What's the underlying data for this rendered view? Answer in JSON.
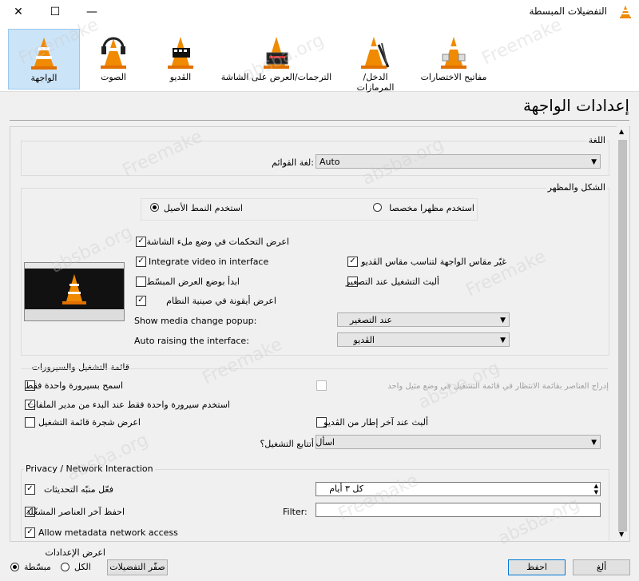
{
  "window": {
    "title": "التفضيلات المبسطة",
    "min": "—",
    "max": "☐",
    "close": "✕"
  },
  "categories": [
    {
      "label": "الواجهة",
      "icon": "interface-cone-icon"
    },
    {
      "label": "الصوت",
      "icon": "audio-cone-icon"
    },
    {
      "label": "الڤديو",
      "icon": "video-cone-icon"
    },
    {
      "label": "الترجمات/العرض على الشاشة",
      "icon": "subtitles-cone-icon"
    },
    {
      "label": "الدخل/المرمازات",
      "icon": "codecs-cone-icon"
    },
    {
      "label": "مفاتيح الاختصارات",
      "icon": "hotkeys-cone-icon"
    }
  ],
  "page_title": "إعدادات الواجهة",
  "language": {
    "group": "اللغة",
    "label": "لغة القوائم:",
    "value": "Auto"
  },
  "look": {
    "group": "الشكل والمظهر",
    "native": "استخدم النمط الأصيل",
    "custom": "استخدم مظهرا مخصصا",
    "fullscreen": "اعرض التحكمات في وضع ملء الشاشة",
    "integrate": "Integrate video in interface",
    "resize": "غيّر مقاس الواجهة لتناسب مقاس الڤديو",
    "minimal": "ابدأ بوضع العرض المبسّط",
    "pause_min": "ألبث التشغيل عند التصغير",
    "systray": "اعرض أيقونة في صينية النظام",
    "popup_label": "Show media change popup:",
    "popup_value": "عند التصغير",
    "raise_label": "Auto raising the interface:",
    "raise_value": "الڤديو"
  },
  "playlist": {
    "group": "قائمة التشغيل والسيرورات",
    "one_instance": "اسمح بسيرورة واحدة فقط",
    "enqueue": "إدراج العناصر بقائمة الانتظار في قائمة التشغيل في وضع مثيل واحد",
    "file_manager": "استخدم سيرورة واحدة فقط عند البدء من مدير الملفات",
    "tree": "اعرض شجرة قائمة التشغيل",
    "pause_last": "ألبث عند آخر إطار من الڤديو",
    "continue_label": "أتتابع التشغيل؟",
    "continue_value": "اسأل"
  },
  "privacy": {
    "group": "Privacy / Network Interaction",
    "updates": "فعّل منبّه التحديثات",
    "updates_value": "كل ٣ أيام",
    "recent": "احفظ آخر العناصر المشغّلة",
    "filter_label": "Filter:",
    "filter_value": "",
    "metadata": "Allow metadata network access"
  },
  "footer": {
    "show_label": "اعرض الإعدادات",
    "simple": "مبسّطة",
    "all": "الكل",
    "reset": "صفّر التفضيلات",
    "save": "احفظ",
    "cancel": "ألغ"
  },
  "watermarks": [
    "Freemake",
    "absba.org"
  ]
}
